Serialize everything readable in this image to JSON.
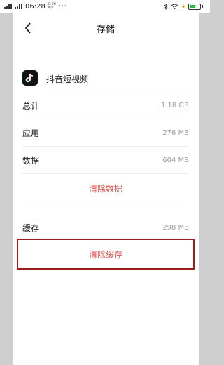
{
  "status_bar": {
    "time": "06:28",
    "speed_top": "0.20",
    "speed_bottom": "K/s",
    "more": "···"
  },
  "nav": {
    "title": "存储"
  },
  "app": {
    "name": "抖音短视频"
  },
  "storage": {
    "total": {
      "label": "总计",
      "value": "1.18 GB"
    },
    "apps": {
      "label": "应用",
      "value": "276 MB"
    },
    "data": {
      "label": "数据",
      "value": "604 MB"
    },
    "clear_data_label": "清除数据",
    "cache": {
      "label": "缓存",
      "value": "298 MB"
    },
    "clear_cache_label": "清除缓存"
  },
  "colors": {
    "accent_red": "#d9534f",
    "highlight_border": "#9b1c1c",
    "battery_green": "#31b34a"
  }
}
